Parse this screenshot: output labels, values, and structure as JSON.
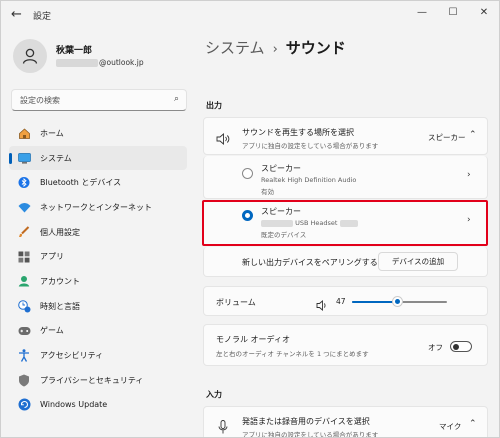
{
  "window": {
    "title": "設定",
    "back_icon": "back-arrow-icon",
    "minimize": "—",
    "maximize": "☐",
    "close": "✕"
  },
  "user": {
    "name": "秋葉一郎",
    "email_suffix": "@outlook.jp"
  },
  "search": {
    "placeholder": "設定の検索"
  },
  "nav": {
    "items": [
      {
        "label": "ホーム",
        "icon": "home-icon",
        "active": false
      },
      {
        "label": "システム",
        "icon": "system-icon",
        "active": true
      },
      {
        "label": "Bluetooth とデバイス",
        "icon": "bluetooth-icon",
        "active": false
      },
      {
        "label": "ネットワークとインターネット",
        "icon": "network-icon",
        "active": false
      },
      {
        "label": "個人用設定",
        "icon": "personalization-icon",
        "active": false
      },
      {
        "label": "アプリ",
        "icon": "apps-icon",
        "active": false
      },
      {
        "label": "アカウント",
        "icon": "account-icon",
        "active": false
      },
      {
        "label": "時刻と言語",
        "icon": "time-language-icon",
        "active": false
      },
      {
        "label": "ゲーム",
        "icon": "gaming-icon",
        "active": false
      },
      {
        "label": "アクセシビリティ",
        "icon": "accessibility-icon",
        "active": false
      },
      {
        "label": "プライバシーとセキュリティ",
        "icon": "privacy-icon",
        "active": false
      },
      {
        "label": "Windows Update",
        "icon": "windows-update-icon",
        "active": false
      }
    ]
  },
  "breadcrumb": {
    "parent": "システム",
    "current": "サウンド"
  },
  "output": {
    "section_label": "出力",
    "choose": {
      "title": "サウンドを再生する場所を選択",
      "subtitle": "アプリに独自の設定をしている場合があります",
      "value": "スピーカー"
    },
    "device1": {
      "name": "スピーカー",
      "driver": "Realtek High Definition Audio",
      "status": "有効"
    },
    "device2": {
      "name": "スピーカー",
      "driver": "USB Headset",
      "status": "既定のデバイス"
    },
    "pair": {
      "label": "新しい出力デバイスをペアリングする",
      "button": "デバイスの追加"
    },
    "volume": {
      "label": "ボリューム",
      "value": "47",
      "level": 0.47
    },
    "mono": {
      "title": "モノラル オーディオ",
      "subtitle": "左と右のオーディオ チャンネルを 1 つにまとめます",
      "state": "オフ"
    }
  },
  "input": {
    "section_label": "入力",
    "choose": {
      "title": "発語または録音用のデバイスを選択",
      "subtitle": "アプリに独自の設定をしている場合があります",
      "value": "マイク"
    }
  },
  "colors": {
    "accent": "#0067c0",
    "highlight": "#e2001a"
  }
}
